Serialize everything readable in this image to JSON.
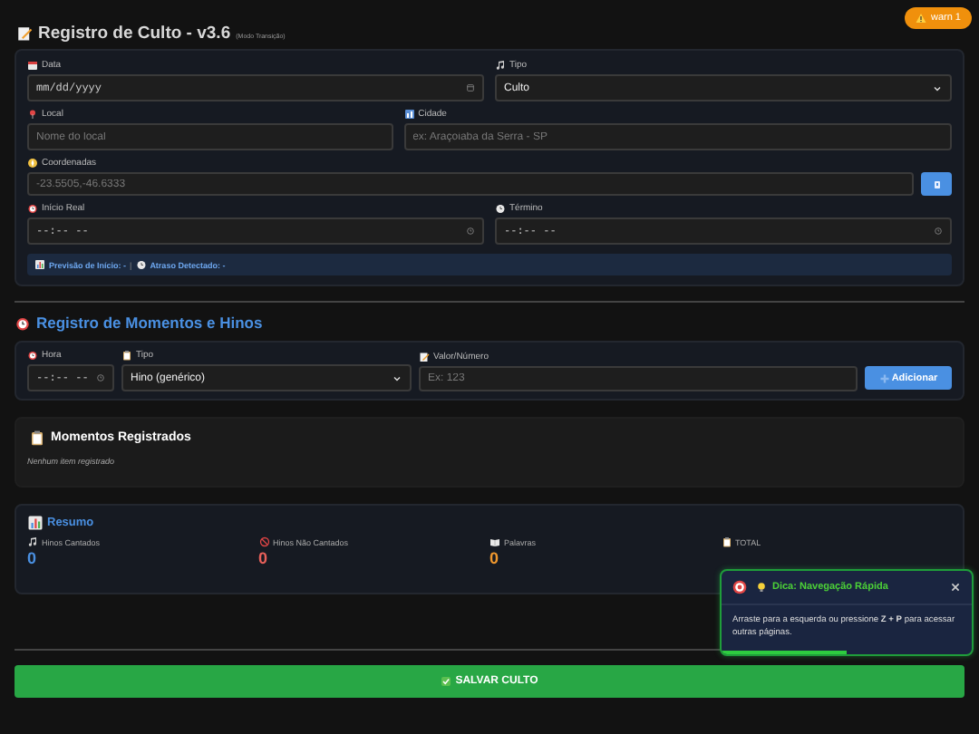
{
  "status_badge": {
    "label": "warn 1"
  },
  "header": {
    "title": "Registro de Culto - v3.6",
    "subtitle": "(Modo Transição)"
  },
  "service_form": {
    "rows": [
      [
        {
          "kind": "date",
          "label": "Data",
          "placeholder": "mm/dd/yyyy"
        },
        {
          "kind": "select",
          "label": "Tipo",
          "value": "Culto"
        }
      ],
      [
        {
          "kind": "text",
          "label": "Local",
          "placeholder": "Nome do local"
        },
        {
          "kind": "text",
          "label": "Cidade",
          "placeholder": "ex: Araçoiaba da Serra - SP"
        }
      ],
      [
        {
          "kind": "text",
          "label": "Coordenadas",
          "placeholder": "-23.5505,-46.6333",
          "has_button": true
        }
      ],
      [
        {
          "kind": "time",
          "label": "Início Real",
          "placeholder": "--:-- --"
        },
        {
          "kind": "time",
          "label": "Término",
          "placeholder": "--:-- --"
        }
      ]
    ],
    "info": [
      "Previsão de Início: -",
      "|",
      "Atraso Detectado: -"
    ]
  },
  "moments_title": "Registro de Momentos e Hinos",
  "moments_form": {
    "fields": [
      {
        "kind": "time",
        "label": "Hora",
        "placeholder": "--:-- --"
      },
      {
        "kind": "select",
        "label": "Tipo",
        "value": "Hino (genérico)"
      },
      {
        "kind": "text",
        "label": "Valor/Número",
        "placeholder": "Ex: 123"
      }
    ],
    "button": "Adicionar"
  },
  "registered": {
    "title": "Momentos Registrados",
    "empty_text": "Nenhum item registrado"
  },
  "summary": {
    "title": "Resumo",
    "stats": [
      {
        "label": "Hinos Cantados",
        "value": "0",
        "color": "#4a90e2"
      },
      {
        "label": "Hinos Não Cantados",
        "value": "0",
        "color": "#e8605a"
      },
      {
        "label": "Palavras",
        "value": "0",
        "color": "#f0982e"
      },
      {
        "label": "TOTAL"
      }
    ]
  },
  "toast": {
    "title": "Dica: Navegação Rápida",
    "text": "Arraste para a esquerda ou pressione **Z + P** para acessar outras páginas.",
    "level": 0.5
  },
  "save_button": "SALVAR CULTO"
}
